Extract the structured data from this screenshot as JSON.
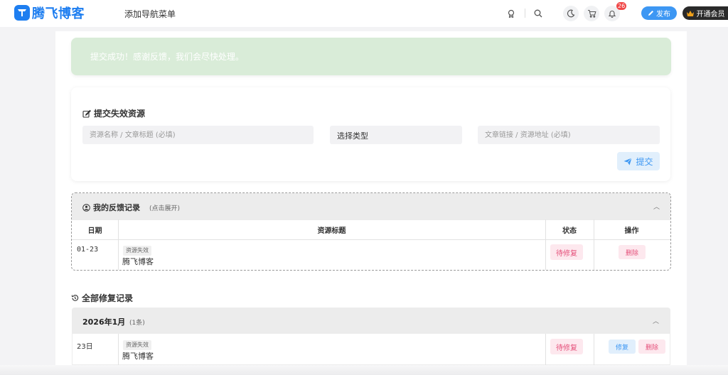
{
  "header": {
    "logo_text": "腾飞博客",
    "nav_menu": "添加导航菜单",
    "notification_count": "26",
    "publish_label": "发布",
    "vip_label": "开通会员",
    "icons": [
      "award-icon",
      "search-icon",
      "moon-icon",
      "cart-icon",
      "bell-icon"
    ]
  },
  "alert": {
    "message": "提交成功！感谢反馈，我们会尽快处理。"
  },
  "form": {
    "title": "提交失效资源",
    "name_placeholder": "资源名称 / 文章标题 (必填)",
    "type_select": "选择类型",
    "link_placeholder": "文章链接 / 资源地址 (必填)",
    "submit_label": "提交"
  },
  "feedback": {
    "title": "我的反馈记录",
    "subtitle": "(点击展开)",
    "columns": [
      "日期",
      "资源标题",
      "状态",
      "操作"
    ],
    "rows": [
      {
        "date": "01-23",
        "tag": "资源失效",
        "title": "腾飞博客",
        "status": "待修复",
        "action": "删除"
      }
    ]
  },
  "history": {
    "title": "全部修复记录",
    "month": "2026年1月",
    "count": "(1条)",
    "rows": [
      {
        "date": "23日",
        "tag": "资源失效",
        "title": "腾飞博客",
        "status": "待修复",
        "fix": "修复",
        "delete": "删除"
      }
    ]
  },
  "colors": {
    "brand": "#1e7ef0",
    "accent": "#3d97f3",
    "success_bg": "#d9ecd8",
    "danger": "#e5507a",
    "badge": "#f04848"
  }
}
